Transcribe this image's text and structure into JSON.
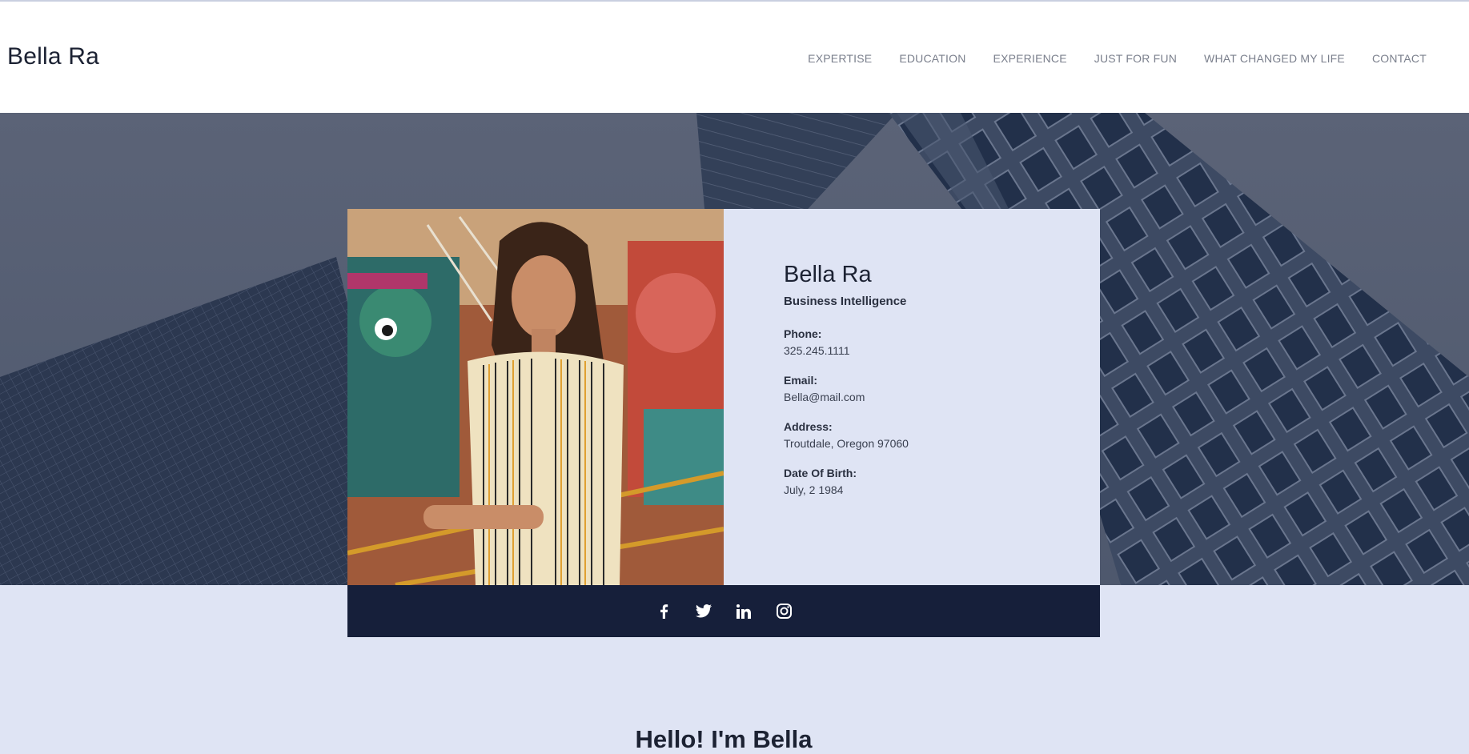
{
  "header": {
    "brand": "Bella Ra",
    "nav": [
      {
        "label": "EXPERTISE"
      },
      {
        "label": "EDUCATION"
      },
      {
        "label": "EXPERIENCE"
      },
      {
        "label": "JUST FOR FUN"
      },
      {
        "label": "WHAT CHANGED MY LIFE"
      },
      {
        "label": "CONTACT"
      }
    ]
  },
  "profile": {
    "name": "Bella Ra",
    "role": "Business Intelligence",
    "fields": [
      {
        "label": "Phone:",
        "value": "325.245.1111"
      },
      {
        "label": "Email:",
        "value": "Bella@mail.com"
      },
      {
        "label": "Address:",
        "value": "Troutdale, Oregon 97060"
      },
      {
        "label": "Date Of Birth:",
        "value": "July, 2 1984"
      }
    ]
  },
  "social": {
    "icons": [
      "facebook-icon",
      "twitter-icon",
      "linkedin-icon",
      "instagram-icon"
    ]
  },
  "intro": {
    "heading": "Hello! I'm Bella"
  },
  "colors": {
    "accent_dark": "#161f3a",
    "card_bg": "#dfe4f4",
    "text": "#1c2233"
  }
}
